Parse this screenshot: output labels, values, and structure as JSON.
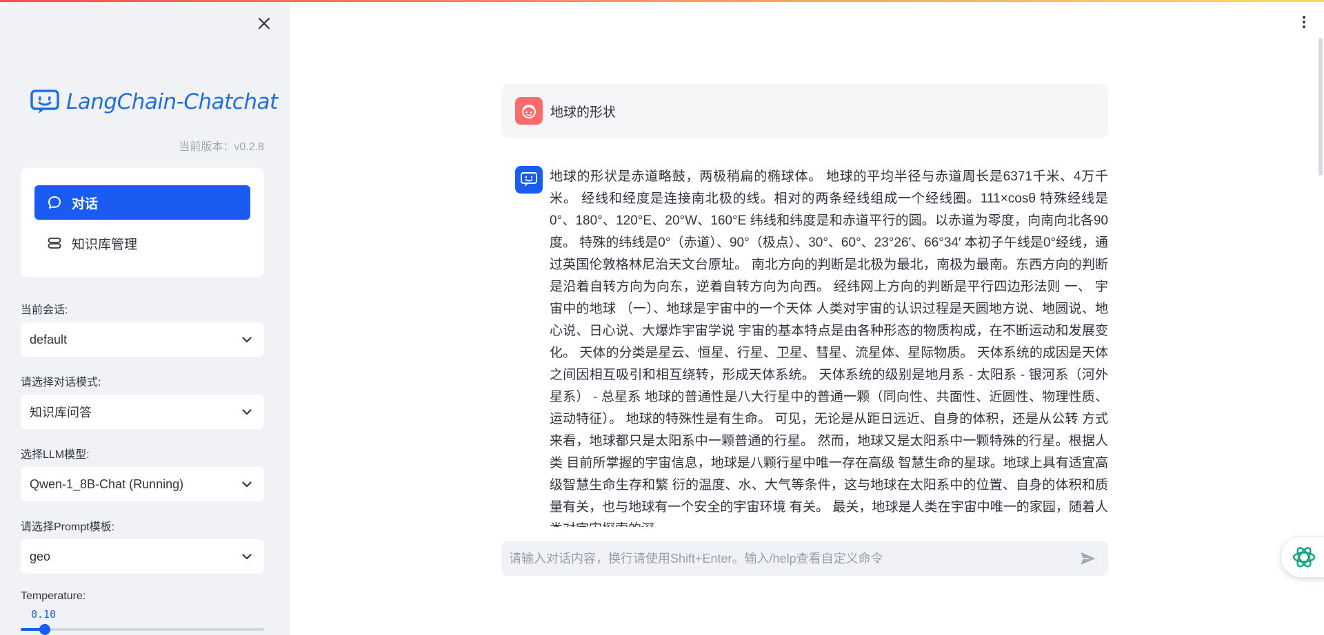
{
  "app": {
    "logo_text": "LangChain-Chatchat",
    "version_text": "当前版本：v0.2.8",
    "accent_color": "#1a5cf1"
  },
  "sidebar": {
    "menu": [
      {
        "label": "对话",
        "icon": "chat-bubble-icon",
        "active": true
      },
      {
        "label": "知识库管理",
        "icon": "database-icon",
        "active": false
      }
    ],
    "session": {
      "label": "当前会话:",
      "value": "default"
    },
    "mode": {
      "label": "请选择对话模式:",
      "value": "知识库问答"
    },
    "llm": {
      "label": "选择LLM模型:",
      "value": "Qwen-1_8B-Chat (Running)"
    },
    "prompt": {
      "label": "请选择Prompt模板:",
      "value": "geo"
    },
    "temperature": {
      "label": "Temperature:",
      "value": "0.10",
      "fraction": 0.1
    }
  },
  "chat": {
    "user_message": "地球的形状",
    "assistant_message": "地球的形状是赤道略鼓，两极稍扁的椭球体。 地球的平均半径与赤道周长是6371千米、4万千米。 经线和经度是连接南北极的线。相对的两条经线组成一个经线圈。111×cosθ 特殊经线是0°、180°、120°E、20°W、160°E 纬线和纬度是和赤道平行的圆。以赤道为零度，向南向北各90度。 特殊的纬线是0°（赤道）、90°（极点）、30°、60°、23°26′、66°34′ 本初子午线是0°经线，通过英国伦敦格林尼治天文台原址。 南北方向的判断是北极为最北，南极为最南。东西方向的判断是沿着自转方向为向东，逆着自转方向为向西。 经纬网上方向的判断是平行四边形法则 一、 宇宙中的地球 （一）、地球是宇宙中的一个天体 人类对宇宙的认识过程是天圆地方说、地圆说、地心说、日心说、大爆炸宇宙学说 宇宙的基本特点是由各种形态的物质构成，在不断运动和发展变化。 天体的分类是星云、恒星、行星、卫星、彗星、流星体、星际物质。 天体系统的成因是天体之间因相互吸引和相互绕转，形成天体系统。 天体系统的级别是地月系 - 太阳系 - 银河系（河外星系） - 总星系 地球的普通性是八大行星中的普通一颗（同向性、共面性、近圆性、物理性质、运动特征）。 地球的特殊性是有生命。 可见，无论是从距日远近、自身的体积，还是从公转 方式来看，地球都只是太阳系中一颗普通的行星。 然而，地球又是太阳系中一颗特殊的行星。根据人类 目前所掌握的宇宙信息，地球是八颗行星中唯一存在高级 智慧生命的星球。地球上具有适宜高级智慧生命生存和繁 衍的温度、水、大气等条件，这与地球在太阳系中的位置、自身的体积和质量有关，也与地球有一个安全的宇宙环境 有关。 最关，地球是人类在宇宙中唯一的家园，随着人类对宇宙探索的深",
    "input_placeholder": "请输入对话内容，换行请使用Shift+Enter。输入/help查看自定义命令"
  }
}
